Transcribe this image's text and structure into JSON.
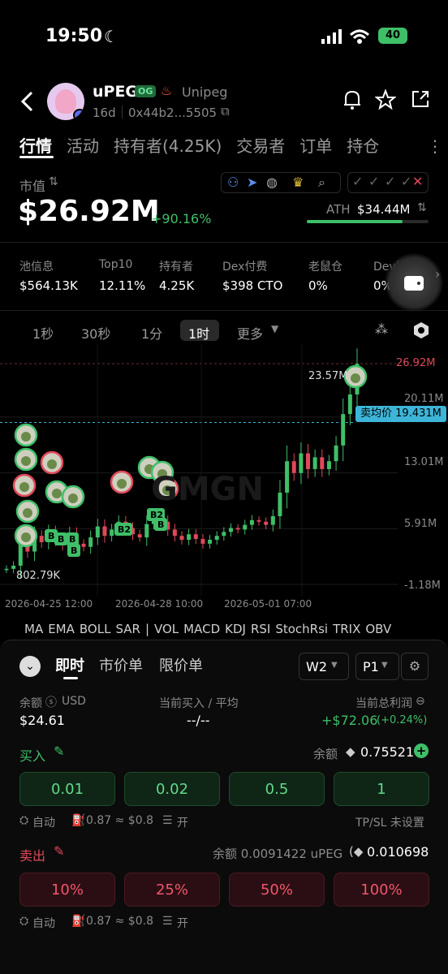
{
  "status": {
    "time": "19:50",
    "battery": "40"
  },
  "header": {
    "back_icon": "chevron-left-icon",
    "token_name": "uPEG",
    "og_badge": "OG",
    "platform": "Unipeg",
    "age": "16d",
    "address": "0x44b2...5505"
  },
  "tabs": [
    "行情",
    "活动",
    "持有者(4.25K)",
    "交易者",
    "订单",
    "持仓"
  ],
  "market": {
    "label": "市值",
    "value": "$26.92M",
    "change": "+90.16%",
    "ath_label": "ATH",
    "ath_value": "$34.44M"
  },
  "stats": [
    {
      "label": "池信息",
      "value": "$564.13K"
    },
    {
      "label": "Top10",
      "value": "12.11%"
    },
    {
      "label": "持有者",
      "value": "4.25K"
    },
    {
      "label": "Dex付费",
      "value": "$398 CTO"
    },
    {
      "label": "老鼠仓",
      "value": "0%"
    },
    {
      "label": "Dev持仓",
      "value": "0%"
    }
  ],
  "timeframes": [
    "1秒",
    "30秒",
    "1分",
    "1时",
    "更多"
  ],
  "chart_data": {
    "type": "candlestick",
    "y_ticks": [
      "26.92M",
      "20.11M",
      "13.01M",
      "5.91M",
      "-1.18M"
    ],
    "x_ticks": [
      "2026-04-25 12:00",
      "2026-04-28 10:00",
      "2026-05-01 07:00"
    ],
    "annotations": {
      "high": "23.57M",
      "low": "802.79K",
      "avg_sell_label": "卖均价",
      "avg_sell_value": "19.431M",
      "current": "26.92M"
    },
    "markers": [
      "B",
      "B",
      "B",
      "B",
      "B2",
      "B2",
      "B"
    ],
    "watermark": "GMGN",
    "closes": [
      0.8,
      1.2,
      4.0,
      3.0,
      5.0,
      4.2,
      5.5,
      4.5,
      3.8,
      5.2,
      4.0,
      3.6,
      4.8,
      6.2,
      5.0,
      5.8,
      6.8,
      6.0,
      5.2,
      4.8,
      6.5,
      7.2,
      6.8,
      5.8,
      5.0,
      4.5,
      5.2,
      4.6,
      4.0,
      4.5,
      5.0,
      5.5,
      6.0,
      5.8,
      6.4,
      7.0,
      6.8,
      6.4,
      7.5,
      10.5,
      14.5,
      13.0,
      15.5,
      13.5,
      15.0,
      13.5,
      14.5,
      16.5,
      20.5,
      23.0,
      26.9
    ]
  },
  "indicators": [
    "MA",
    "EMA",
    "BOLL",
    "SAR",
    "|",
    "VOL",
    "MACD",
    "KDJ",
    "RSI",
    "StochRsi",
    "TRIX",
    "OBV"
  ],
  "trade": {
    "tabs": [
      "即时",
      "市价单",
      "限价单"
    ],
    "wallet": "W2",
    "preset": "P1",
    "balance_label": "余额",
    "balance_unit": "USD",
    "balance_value": "$24.61",
    "buy_avg_label": "当前买入 / 平均",
    "buy_avg_value": "--/--",
    "pnl_label": "当前总利润",
    "pnl_value": "+$72.06",
    "pnl_pct": "(+0.24%)",
    "buy_label": "买入",
    "buy_balance_label": "余额",
    "buy_balance_value": "0.75521",
    "buy_amounts": [
      "0.01",
      "0.02",
      "0.5",
      "1"
    ],
    "auto_label": "自动",
    "gas_text": "0.87 ≈ $0.8",
    "open_label": "开",
    "tpsl_label": "TP/SL 未设置",
    "sell_label": "卖出",
    "sell_balance_text": "余额 0.0091422 uPEG",
    "sell_balance_value": "0.010698",
    "sell_pcts": [
      "10%",
      "25%",
      "50%",
      "100%"
    ]
  }
}
